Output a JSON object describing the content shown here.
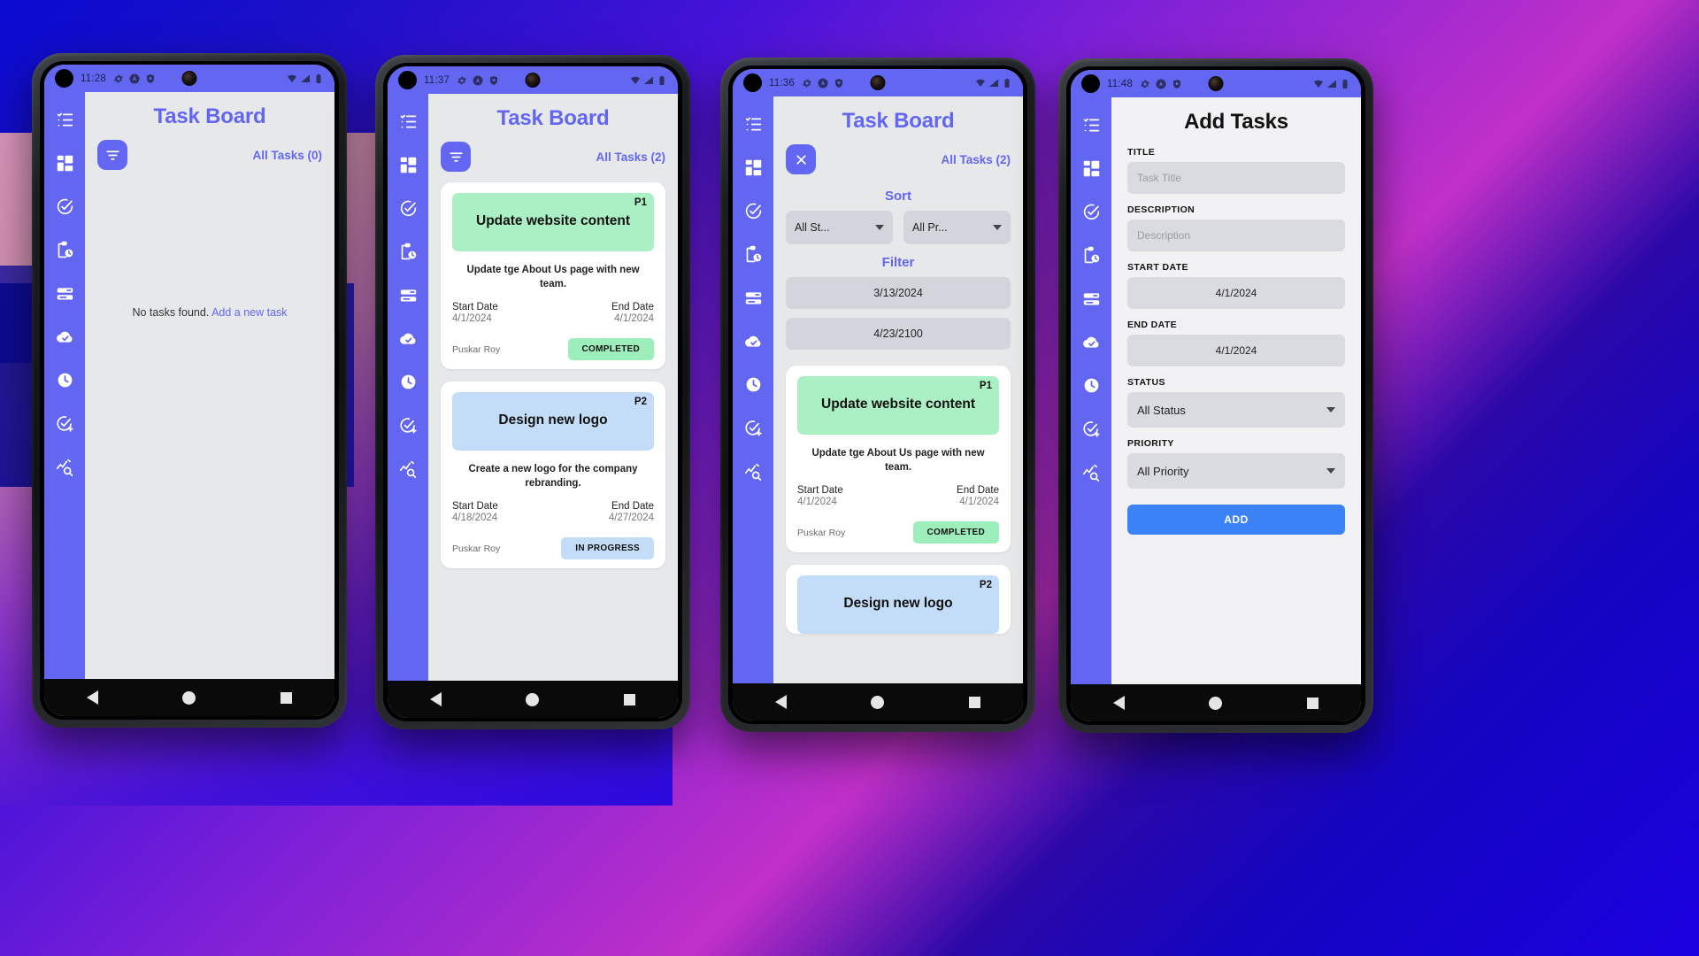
{
  "background": {
    "accent": "#6366f1",
    "screen_bg": "#e7e8ea",
    "card_bg": "#ffffff"
  },
  "sidebar": {
    "items": [
      {
        "name": "checklist-icon",
        "label": "Task List"
      },
      {
        "name": "dashboard-grid-icon",
        "label": "Dashboard"
      },
      {
        "name": "check-circle-icon",
        "label": "Completed"
      },
      {
        "name": "clipboard-clock-icon",
        "label": "Pending"
      },
      {
        "name": "list-lines-icon",
        "label": "Backlog"
      },
      {
        "name": "cloud-check-icon",
        "label": "Synced"
      },
      {
        "name": "clock-icon",
        "label": "Recent"
      },
      {
        "name": "check-circle-plus-icon",
        "label": "Add Task"
      },
      {
        "name": "analytics-search-icon",
        "label": "Analytics"
      }
    ]
  },
  "phone1": {
    "status": {
      "time": "11:28"
    },
    "title": "Task Board",
    "filter_button": "filter-icon",
    "all_tasks": "All Tasks (0)",
    "empty_text": "No tasks found.",
    "empty_link": "Add a new task"
  },
  "phone2": {
    "status": {
      "time": "11:37"
    },
    "title": "Task Board",
    "filter_button": "filter-icon",
    "all_tasks": "All Tasks (2)",
    "cards": [
      {
        "priority": "P1",
        "title": "Update website content",
        "color": "green",
        "description": "Update tge About Us page with new team.",
        "start_label": "Start Date",
        "start_date": "4/1/2024",
        "end_label": "End Date",
        "end_date": "4/1/2024",
        "assignee": "Puskar Roy",
        "status": "COMPLETED",
        "status_class": "done"
      },
      {
        "priority": "P2",
        "title": "Design new logo",
        "color": "blue",
        "description": "Create a new logo for the company rebranding.",
        "start_label": "Start Date",
        "start_date": "4/18/2024",
        "end_label": "End Date",
        "end_date": "4/27/2024",
        "assignee": "Puskar Roy",
        "status": "IN PROGRESS",
        "status_class": "prog"
      }
    ]
  },
  "phone3": {
    "status": {
      "time": "11:36"
    },
    "title": "Task Board",
    "close_button": "close-icon",
    "all_tasks": "All Tasks (2)",
    "sort_heading": "Sort",
    "sort_status": "All St...",
    "sort_priority": "All Pr...",
    "filter_heading": "Filter",
    "filter_date_from": "3/13/2024",
    "filter_date_to": "4/23/2100",
    "cards": [
      {
        "priority": "P1",
        "title": "Update website content",
        "color": "green",
        "description": "Update tge About Us page with new team.",
        "start_label": "Start Date",
        "start_date": "4/1/2024",
        "end_label": "End Date",
        "end_date": "4/1/2024",
        "assignee": "Puskar Roy",
        "status": "COMPLETED",
        "status_class": "done"
      },
      {
        "priority": "P2",
        "title": "Design new logo",
        "color": "blue",
        "description": "",
        "start_label": "",
        "start_date": "",
        "end_label": "",
        "end_date": "",
        "assignee": "",
        "status": "",
        "status_class": "prog"
      }
    ]
  },
  "phone4": {
    "status": {
      "time": "11:48"
    },
    "title": "Add Tasks",
    "fields": {
      "title_label": "TITLE",
      "title_placeholder": "Task Title",
      "desc_label": "DESCRIPTION",
      "desc_placeholder": "Description",
      "start_label": "START DATE",
      "start_value": "4/1/2024",
      "end_label": "END DATE",
      "end_value": "4/1/2024",
      "status_label": "STATUS",
      "status_value": "All Status",
      "priority_label": "PRIORITY",
      "priority_value": "All Priority",
      "add_button": "ADD"
    }
  },
  "navbar": {
    "back": "back-triangle-icon",
    "home": "home-circle-icon",
    "recents": "recents-square-icon"
  }
}
